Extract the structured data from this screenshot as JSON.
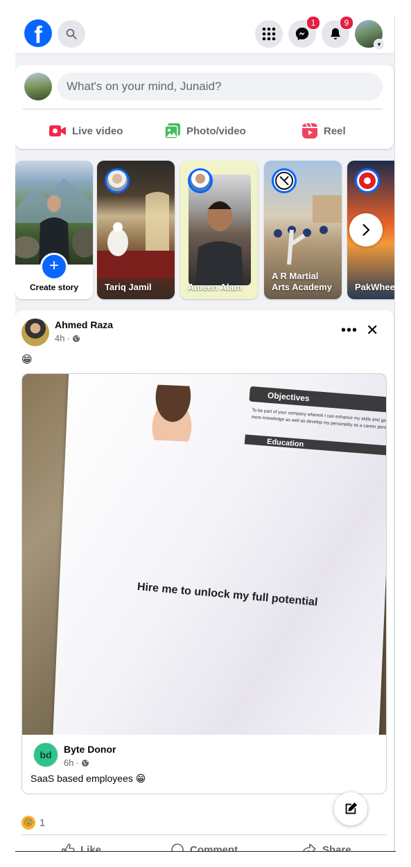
{
  "header": {
    "logo_letter": "f",
    "messenger_badge": "1",
    "notifications_badge": "9"
  },
  "composer": {
    "placeholder": "What's on your mind, Junaid?",
    "actions": [
      {
        "label": "Live video",
        "icon": "live-video-icon",
        "color": "#f02849"
      },
      {
        "label": "Photo/video",
        "icon": "photo-video-icon",
        "color": "#45bd62"
      },
      {
        "label": "Reel",
        "icon": "reel-icon",
        "color": "#f3425f"
      }
    ]
  },
  "stories": {
    "create_label": "Create story",
    "items": [
      {
        "label": "Tariq Jamil"
      },
      {
        "label": "Ameen Alam"
      },
      {
        "label": "A R Martial Arts Academy"
      },
      {
        "label": "PakWheels.com"
      }
    ]
  },
  "post": {
    "author": "Ahmed Raza",
    "time": "4h",
    "dot": "·",
    "text": "😁",
    "image": {
      "objectives_heading": "Objectives",
      "objectives_text": "To be part of your company wherein I can enhance my skills and gain more knowledge as well as develop my personality as a career person.",
      "education_heading": "Education",
      "caption": "Hire me to unlock my full potential"
    },
    "shared": {
      "author": "Byte Donor",
      "time": "6h",
      "text": "SaaS based employees 😁"
    },
    "reaction_emoji": "😝",
    "reaction_count": "1",
    "actions": {
      "like": "Like",
      "comment": "Comment",
      "share": "Share"
    }
  },
  "colors": {
    "brand": "#0866ff",
    "badge": "#e41e3f"
  }
}
